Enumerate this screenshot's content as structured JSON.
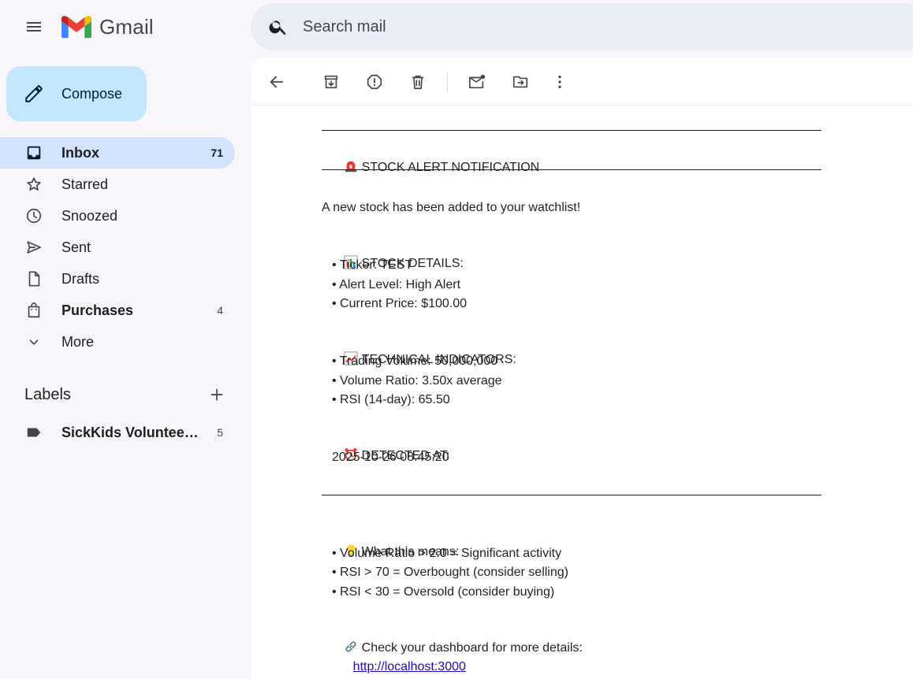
{
  "app": {
    "name": "Gmail"
  },
  "search": {
    "placeholder": "Search mail"
  },
  "compose": {
    "label": "Compose"
  },
  "nav": {
    "items": [
      {
        "label": "Inbox",
        "count": "71"
      },
      {
        "label": "Starred",
        "count": ""
      },
      {
        "label": "Snoozed",
        "count": ""
      },
      {
        "label": "Sent",
        "count": ""
      },
      {
        "label": "Drafts",
        "count": ""
      },
      {
        "label": "Purchases",
        "count": "4"
      },
      {
        "label": "More",
        "count": ""
      }
    ]
  },
  "labels": {
    "title": "Labels",
    "items": [
      {
        "name": "SickKids Volunteeri...",
        "count": "5"
      }
    ]
  },
  "email": {
    "alert_title": "STOCK ALERT NOTIFICATION",
    "intro": "A new stock has been added to your watchlist!",
    "details_head": "STOCK DETAILS:",
    "details": [
      "• Ticker: TEST",
      "• Alert Level: High Alert",
      "• Current Price: $100.00"
    ],
    "indicators_head": "TECHNICAL INDICATORS:",
    "indicators": [
      "• Trading Volume: 50,000,000",
      "• Volume Ratio: 3.50x average",
      "• RSI (14-day): 65.50"
    ],
    "detected_head": "DETECTED AT:",
    "detected_value": "2025-10-26 08:45:20",
    "means_head": "What this means:",
    "means": [
      "• Volume Ratio > 2.0 = Significant activity",
      "• RSI > 70 = Overbought (consider selling)",
      "• RSI < 30 = Oversold (consider buying)"
    ],
    "dashboard_text": "Check your dashboard for more details:",
    "dashboard_link": "http://localhost:3000"
  },
  "colors": {
    "background": "#f8f5fb",
    "active_nav": "#d3e3fd",
    "compose": "#c2e7ff",
    "search": "#e9eef6",
    "link": "#1a0dab"
  }
}
